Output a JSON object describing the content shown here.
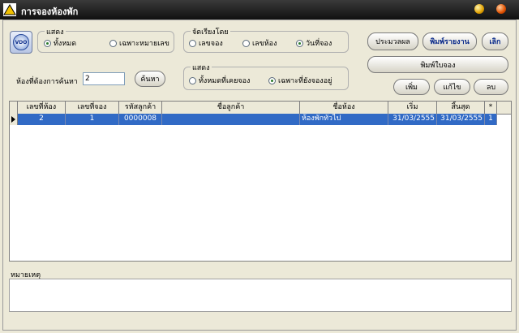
{
  "window": {
    "title": "การจองห้องพัก"
  },
  "logo": {
    "text": "VDO"
  },
  "show_group": {
    "label": "แสดง",
    "options": [
      {
        "label": "ทั้งหมด",
        "checked": true
      },
      {
        "label": "เฉพาะหมายเลข",
        "checked": false
      }
    ]
  },
  "sort_group": {
    "label": "จัดเรียงโดย",
    "options": [
      {
        "label": "เลขจอง",
        "checked": false
      },
      {
        "label": "เลขห้อง",
        "checked": false
      },
      {
        "label": "วันที่จอง",
        "checked": true
      }
    ]
  },
  "status_group": {
    "label": "แสดง",
    "options": [
      {
        "label": "ทั้งหมดที่เคยจอง",
        "checked": false
      },
      {
        "label": "เฉพาะที่ยังจองอยู่",
        "checked": true
      }
    ]
  },
  "search": {
    "label": "ห้องที่ต้องการค้นหา",
    "value": "2",
    "button": "ค้นหา"
  },
  "buttons": {
    "summary": "ประมวลผล",
    "print_report": "พิมพ์รายงาน",
    "exit": "เลิก",
    "print_receipt": "พิมพ์ใบจอง",
    "add": "เพิ่ม",
    "edit": "แก้ไข",
    "delete": "ลบ"
  },
  "table": {
    "columns": [
      "เลขที่ห้อง",
      "เลขที่จอง",
      "รหัสลูกค้า",
      "ชื่อลูกค้า",
      "ชื่อห้อง",
      "เริ่ม",
      "สิ้นสุด",
      "*"
    ],
    "rows": [
      [
        "2",
        "1",
        "0000008",
        "",
        "ห้องพักทั่วไป",
        "31/03/2555",
        "31/03/2555",
        "1"
      ]
    ]
  },
  "remarks": {
    "label": "หมายเหตุ"
  },
  "colors": {
    "selection": "#316ac5",
    "title_bar": "#1a1a1a",
    "button_text_blue": "#0a2a8a"
  },
  "icons": [
    "triangle-app-icon",
    "minimize-icon",
    "close-icon",
    "row-pointer-icon"
  ]
}
